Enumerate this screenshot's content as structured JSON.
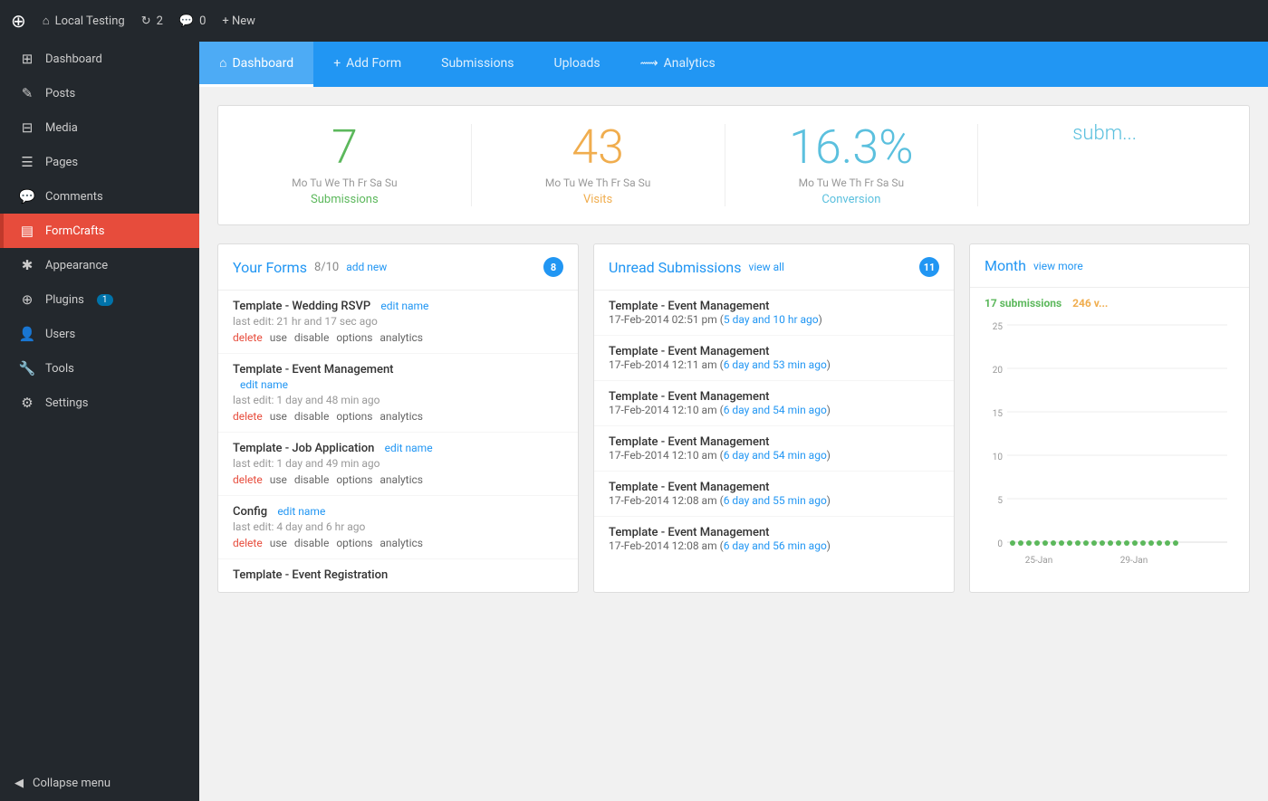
{
  "adminBar": {
    "wpLogo": "⊕",
    "siteName": "Local Testing",
    "updates": "2",
    "comments": "0",
    "newLabel": "+ New"
  },
  "sidebar": {
    "items": [
      {
        "id": "dashboard",
        "icon": "⊞",
        "label": "Dashboard",
        "active": false
      },
      {
        "id": "posts",
        "icon": "✎",
        "label": "Posts",
        "active": false
      },
      {
        "id": "media",
        "icon": "⊟",
        "label": "Media",
        "active": false
      },
      {
        "id": "pages",
        "icon": "☰",
        "label": "Pages",
        "active": false
      },
      {
        "id": "comments",
        "icon": "💬",
        "label": "Comments",
        "active": false
      },
      {
        "id": "formcrafts",
        "icon": "▤",
        "label": "FormCrafts",
        "active": true
      },
      {
        "id": "appearance",
        "icon": "✱",
        "label": "Appearance",
        "active": false
      },
      {
        "id": "plugins",
        "icon": "⊕",
        "label": "Plugins",
        "badge": "1",
        "active": false
      },
      {
        "id": "users",
        "icon": "👤",
        "label": "Users",
        "active": false
      },
      {
        "id": "tools",
        "icon": "🔧",
        "label": "Tools",
        "active": false
      },
      {
        "id": "settings",
        "icon": "⚙",
        "label": "Settings",
        "active": false
      }
    ],
    "collapseLabel": "Collapse menu"
  },
  "navTabs": [
    {
      "id": "dashboard",
      "icon": "⌂",
      "label": "Dashboard",
      "active": true
    },
    {
      "id": "add-form",
      "icon": "+",
      "label": "Add Form",
      "active": false
    },
    {
      "id": "submissions",
      "label": "Submissions",
      "active": false
    },
    {
      "id": "uploads",
      "label": "Uploads",
      "active": false
    },
    {
      "id": "analytics",
      "icon": "⟿",
      "label": "Analytics",
      "active": false
    }
  ],
  "stats": [
    {
      "id": "submissions",
      "number": "7",
      "colorClass": "green",
      "days": "Mo Tu We Th Fr Sa Su",
      "label": "Submissions"
    },
    {
      "id": "visits",
      "number": "43",
      "colorClass": "orange",
      "days": "Mo Tu We Th Fr Sa Su",
      "label": "Visits"
    },
    {
      "id": "conversion",
      "number": "16.3%",
      "colorClass": "blue",
      "days": "Mo Tu We Th Fr Sa Su",
      "label": "Conversion"
    },
    {
      "id": "subm-extra",
      "number": "",
      "colorClass": "blue",
      "days": "",
      "label": "subm..."
    }
  ],
  "yourForms": {
    "title": "Your Forms",
    "count": "8/10",
    "addNew": "add new",
    "badge": "8",
    "items": [
      {
        "name": "Template - Wedding RSVP",
        "editName": "edit name",
        "lastEdit": "last edit: 21 hr and 17 sec ago",
        "actions": [
          "delete",
          "use",
          "disable",
          "options",
          "analytics"
        ]
      },
      {
        "name": "Template - Event Management",
        "editName": "edit name",
        "lastEdit": "last edit: 1 day and 48 min ago",
        "actions": [
          "delete",
          "use",
          "disable",
          "options",
          "analytics"
        ]
      },
      {
        "name": "Template - Job Application",
        "editName": "edit name",
        "lastEdit": "last edit: 1 day and 49 min ago",
        "actions": [
          "delete",
          "use",
          "disable",
          "options",
          "analytics"
        ]
      },
      {
        "name": "Config",
        "editName": "edit name",
        "lastEdit": "last edit: 4 day and 6 hr ago",
        "actions": [
          "delete",
          "use",
          "disable",
          "options",
          "analytics"
        ]
      },
      {
        "name": "Template - Event Registration",
        "editName": "",
        "lastEdit": "",
        "actions": []
      }
    ]
  },
  "unreadSubmissions": {
    "title": "Unread Submissions",
    "viewAll": "view all",
    "badge": "11",
    "items": [
      {
        "form": "Template - Event Management",
        "date": "17-Feb-2014 02:51 pm",
        "ago": "5 day and 10 hr ago"
      },
      {
        "form": "Template - Event Management",
        "date": "17-Feb-2014 12:11 am",
        "ago": "6 day and 53 min ago"
      },
      {
        "form": "Template - Event Management",
        "date": "17-Feb-2014 12:10 am",
        "ago": "6 day and 54 min ago"
      },
      {
        "form": "Template - Event Management",
        "date": "17-Feb-2014 12:10 am",
        "ago": "6 day and 54 min ago"
      },
      {
        "form": "Template - Event Management",
        "date": "17-Feb-2014 12:08 am",
        "ago": "6 day and 55 min ago"
      },
      {
        "form": "Template - Event Management",
        "date": "17-Feb-2014 12:08 am",
        "ago": "6 day and 56 min ago"
      }
    ]
  },
  "month": {
    "title": "Month",
    "viewMore": "view more",
    "submissions": "17 submissions",
    "visits": "246 v...",
    "chartLabels": [
      "25-Jan",
      "29-Jan"
    ],
    "yAxis": [
      0,
      5,
      10,
      15,
      20,
      25
    ]
  }
}
